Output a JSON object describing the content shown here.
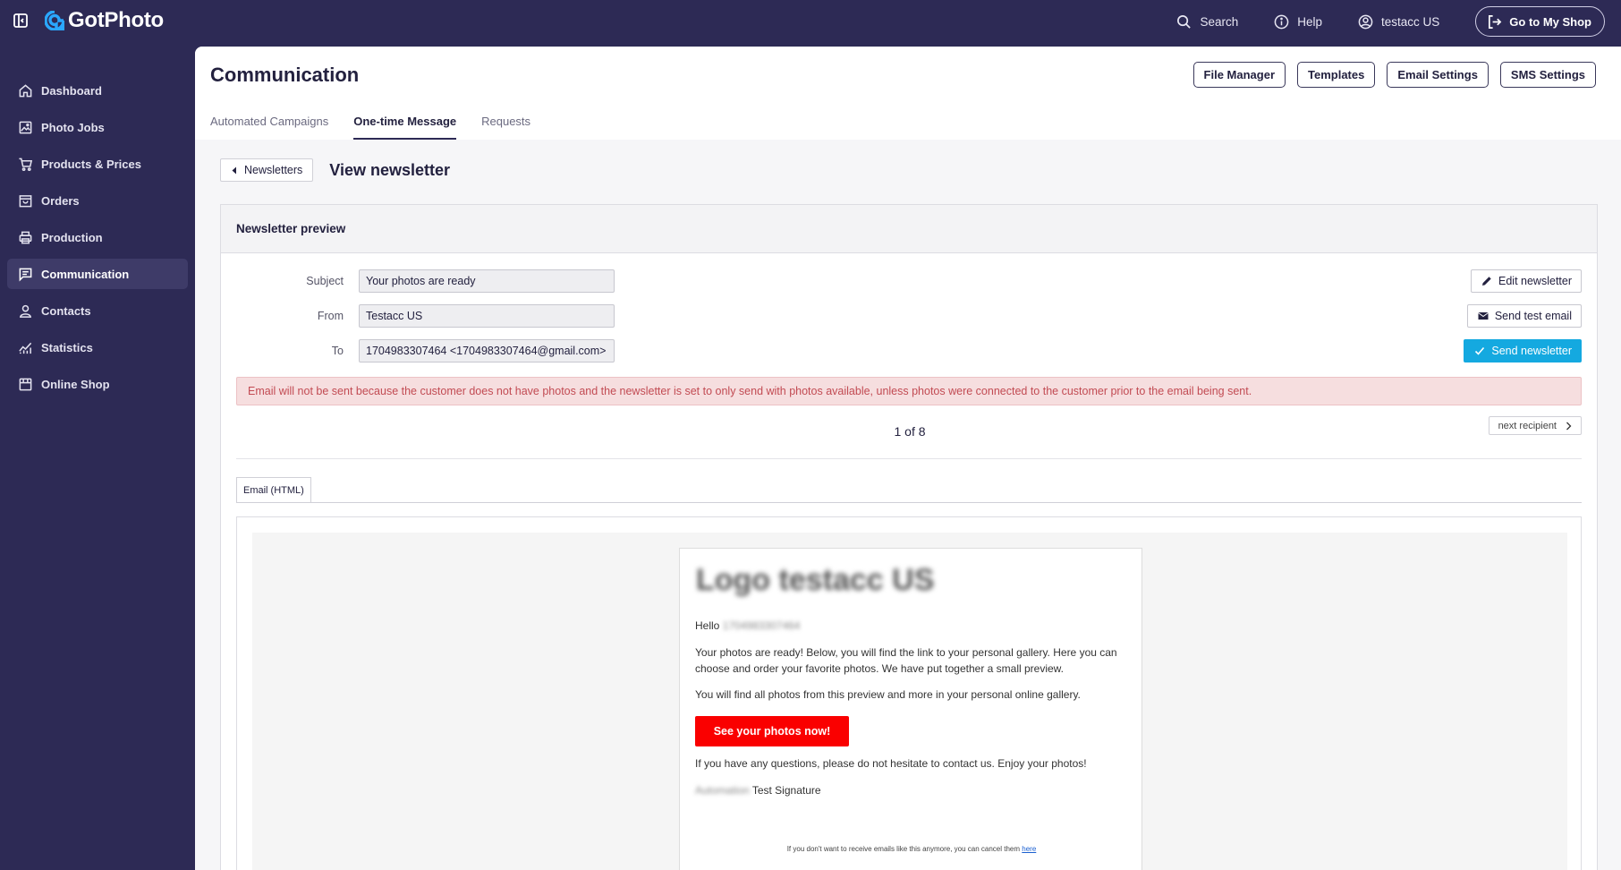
{
  "app": {
    "name": "GotPhoto"
  },
  "topbar": {
    "search_label": "Search",
    "help_label": "Help",
    "user_label": "testacc US",
    "shop_button": "Go to My Shop"
  },
  "sidebar": {
    "items": [
      {
        "label": "Dashboard",
        "icon": "home-icon"
      },
      {
        "label": "Photo Jobs",
        "icon": "photo-icon"
      },
      {
        "label": "Products & Prices",
        "icon": "cart-icon"
      },
      {
        "label": "Orders",
        "icon": "orders-icon"
      },
      {
        "label": "Production",
        "icon": "printer-icon"
      },
      {
        "label": "Communication",
        "icon": "chat-icon",
        "active": true
      },
      {
        "label": "Contacts",
        "icon": "person-icon"
      },
      {
        "label": "Statistics",
        "icon": "chart-icon"
      },
      {
        "label": "Online Shop",
        "icon": "store-icon"
      }
    ]
  },
  "header": {
    "title": "Communication",
    "buttons": {
      "file_manager": "File Manager",
      "templates": "Templates",
      "email_settings": "Email Settings",
      "sms_settings": "SMS Settings"
    },
    "tabs": [
      {
        "label": "Automated Campaigns"
      },
      {
        "label": "One-time Message",
        "active": true
      },
      {
        "label": "Requests"
      }
    ]
  },
  "breadcrumb": {
    "back_label": "Newsletters",
    "view_title": "View newsletter"
  },
  "preview": {
    "heading": "Newsletter preview",
    "subject_label": "Subject",
    "subject_value": "Your photos are ready",
    "from_label": "From",
    "from_value": "Testacc US",
    "to_label": "To",
    "to_value": "1704983307464 <1704983307464@gmail.com>",
    "edit_button": "Edit newsletter",
    "test_button": "Send test email",
    "send_button": "Send newsletter",
    "alert": "Email will not be sent because the customer does not have photos and the newsletter is set to only send with photos available, unless photos were connected to the customer prior to the email being sent.",
    "pager": "1 of 8",
    "next_button": "next recipient",
    "email_tab": "Email (HTML)"
  },
  "email": {
    "logo_text": "Logo testacc US",
    "hello": "Hello",
    "recipient_blur": "1704983307464",
    "paragraph1": "Your photos are ready! Below, you will find the link to your personal gallery. Here you can choose and order your favorite photos. We have put together a small preview.",
    "paragraph2": "You will find all photos from this preview and more in your personal online gallery.",
    "cta": "See your photos now!",
    "paragraph3": "If you have any questions, please do not hesitate to contact us. Enjoy your photos!",
    "signature_blur": "Automation",
    "signature": "Test Signature",
    "footer_text": "If you don't want to receive emails like this anymore, you can cancel them",
    "footer_link": "here"
  },
  "colors": {
    "sidebar_bg": "#2d2a55",
    "primary_button": "#14a9e0",
    "cta": "#fa0000",
    "alert_bg": "#f6dedf",
    "alert_text": "#c24b53"
  }
}
